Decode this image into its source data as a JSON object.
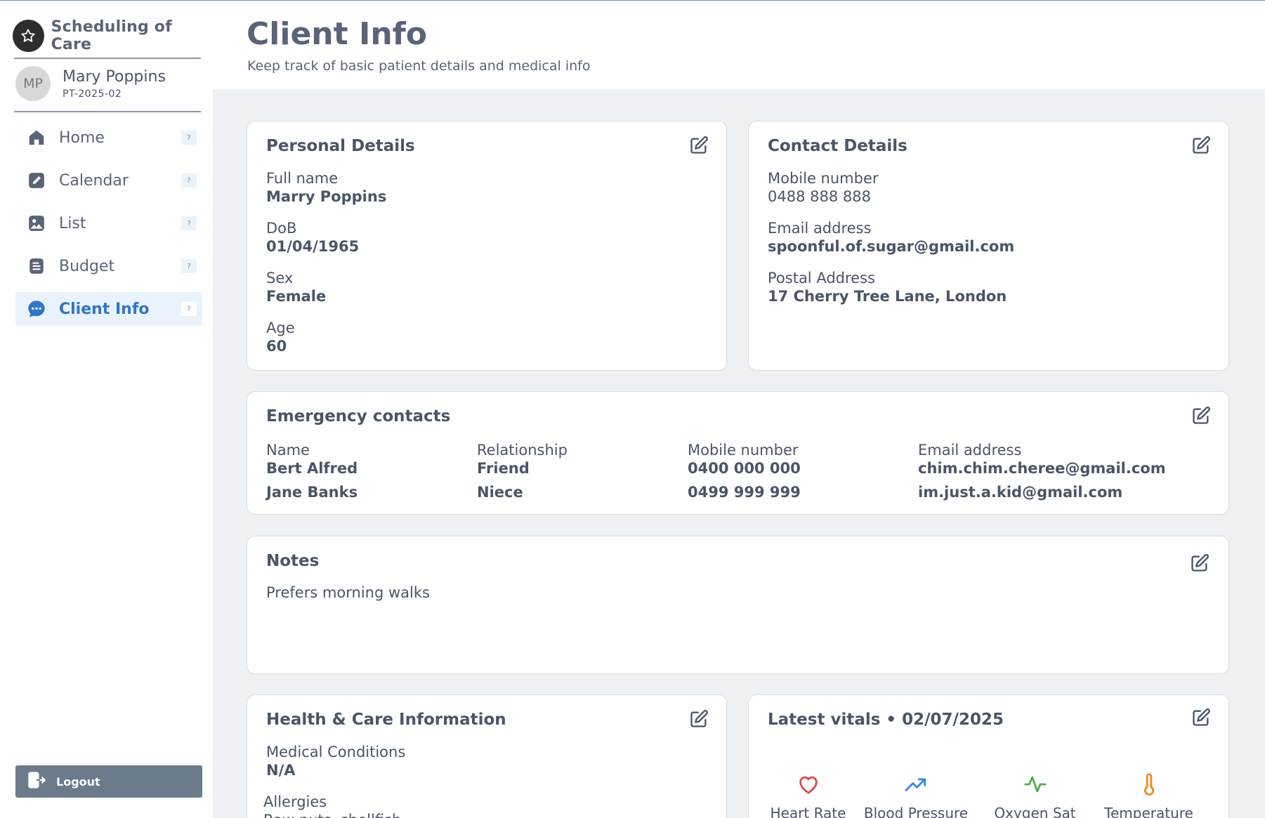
{
  "app": {
    "name": "Scheduling of Care"
  },
  "profile": {
    "initials": "MP",
    "name": "Mary Poppins",
    "id": "PT-2025-02"
  },
  "nav": {
    "items": [
      {
        "label": "Home",
        "icon": "home-icon",
        "help": "?"
      },
      {
        "label": "Calendar",
        "icon": "edit-square-icon",
        "help": "?"
      },
      {
        "label": "List",
        "icon": "image-icon",
        "help": "?"
      },
      {
        "label": "Budget",
        "icon": "document-icon",
        "help": "?"
      },
      {
        "label": "Client Info",
        "icon": "chat-bubble-icon",
        "help": "?",
        "active": true
      }
    ],
    "logout_label": "Logout"
  },
  "header": {
    "title": "Client Info",
    "subtitle": "Keep track of basic patient details and medical info"
  },
  "personal": {
    "title": "Personal Details",
    "full_name_label": "Full name",
    "full_name": "Marry Poppins",
    "dob_label": "DoB",
    "dob": "01/04/1965",
    "sex_label": "Sex",
    "sex": "Female",
    "age_label": "Age",
    "age": "60"
  },
  "contact": {
    "title": "Contact Details",
    "mobile_label": "Mobile number",
    "mobile": "0488 888 888",
    "email_label": "Email address",
    "email": "spoonful.of.sugar@gmail.com",
    "postal_label": "Postal Address",
    "postal": "17 Cherry Tree Lane, London"
  },
  "emergency": {
    "title": "Emergency contacts",
    "headers": {
      "name": "Name",
      "relationship": "Relationship",
      "mobile": "Mobile number",
      "email": "Email address"
    },
    "rows": [
      {
        "name": "Bert Alfred",
        "relationship": "Friend",
        "mobile": "0400 000 000",
        "email": "chim.chim.cheree@gmail.com"
      },
      {
        "name": "Jane Banks",
        "relationship": "Niece",
        "mobile": "0499 999 999",
        "email": "im.just.a.kid@gmail.com"
      }
    ]
  },
  "notes": {
    "title": "Notes",
    "text": "Prefers morning walks"
  },
  "health": {
    "title": "Health & Care Information",
    "conditions_label": "Medical Conditions",
    "conditions": "N/A",
    "allergies_label": "Allergies",
    "allergies": "Raw nuts, shellfish"
  },
  "vitals": {
    "title": "Latest vitals • 02/07/2025",
    "items": [
      {
        "label": "Heart Rate",
        "icon": "heart-icon",
        "color": "#e04848"
      },
      {
        "label": "Blood Pressure",
        "icon": "trending-up-icon",
        "color": "#3b82f6"
      },
      {
        "label": "Oxygen Sat",
        "icon": "pulse-icon",
        "color": "#4caf50"
      },
      {
        "label": "Temperature",
        "icon": "thermometer-icon",
        "color": "#f08a24"
      }
    ]
  },
  "colors": {
    "accent": "#2f76c5",
    "text": "#4a5568",
    "background": "#eef1f4",
    "logout_button": "#6b7b8c"
  }
}
